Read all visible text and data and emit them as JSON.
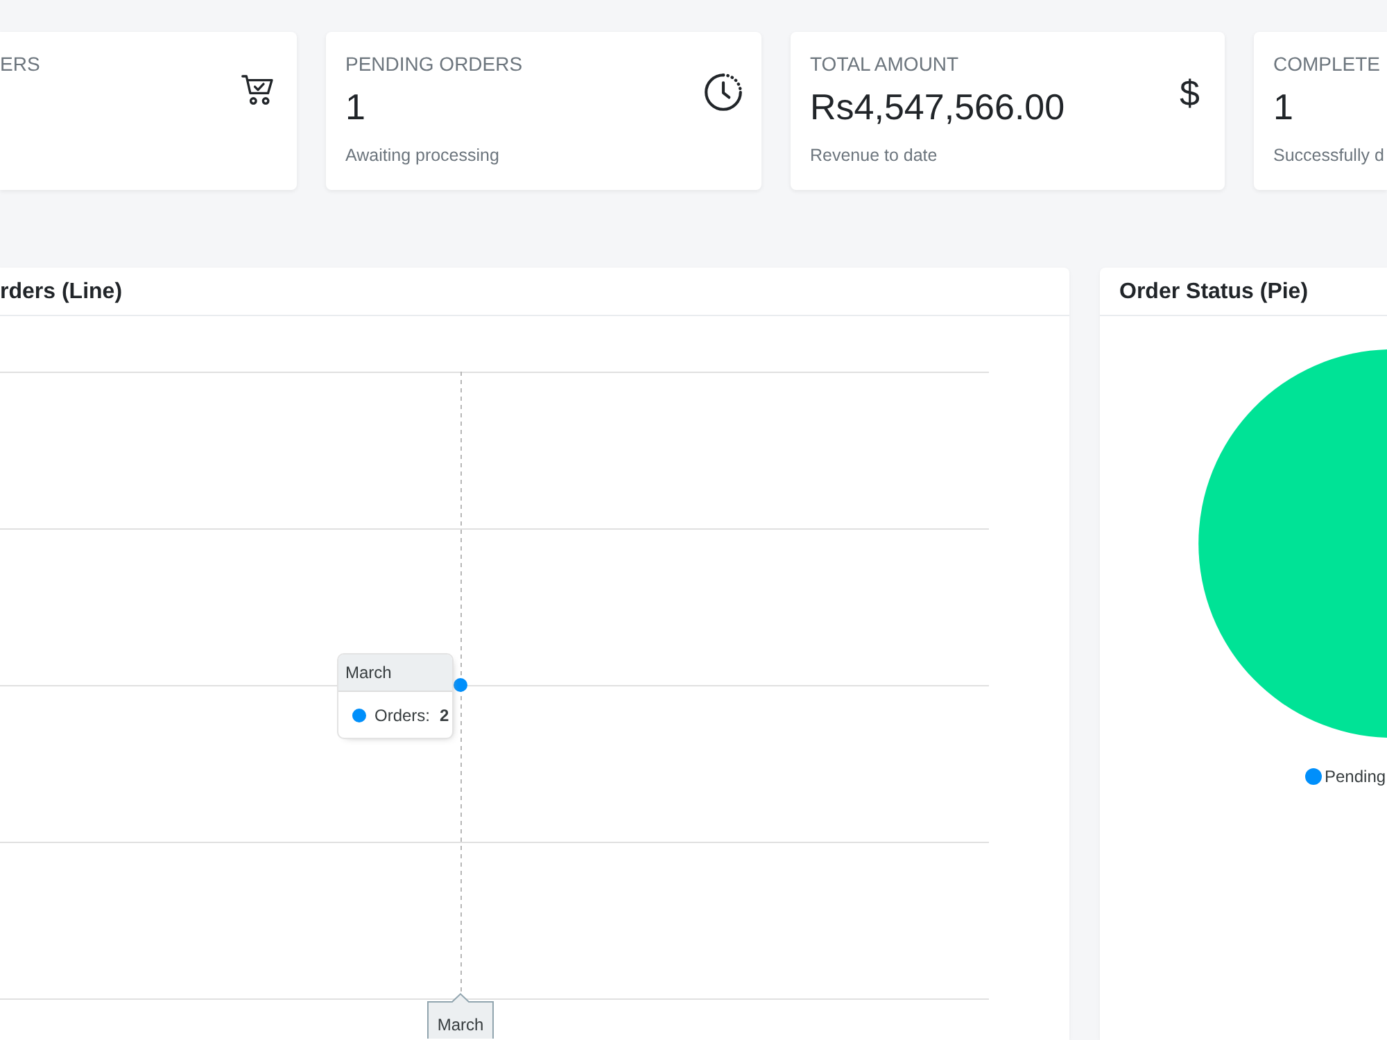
{
  "stat_cards": [
    {
      "label": "ERS"
    },
    {
      "label": "PENDING ORDERS",
      "value": "1",
      "caption": "Awaiting processing"
    },
    {
      "label": "TOTAL AMOUNT",
      "value": "Rs4,547,566.00",
      "caption": "Revenue to date",
      "icon_glyph": "$"
    },
    {
      "label": "COMPLETE",
      "value": "1",
      "caption": "Successfully d"
    }
  ],
  "line_panel": {
    "title": "rders (Line)",
    "tooltip": {
      "title": "March",
      "series": [
        {
          "label": "Orders:",
          "value": "2",
          "color": "#008ffb"
        }
      ]
    },
    "axis_tooltip": "March"
  },
  "pie_panel": {
    "title": "Order Status (Pie)",
    "legend": [
      {
        "label": "Pending",
        "color": "#008ffb"
      }
    ]
  }
}
